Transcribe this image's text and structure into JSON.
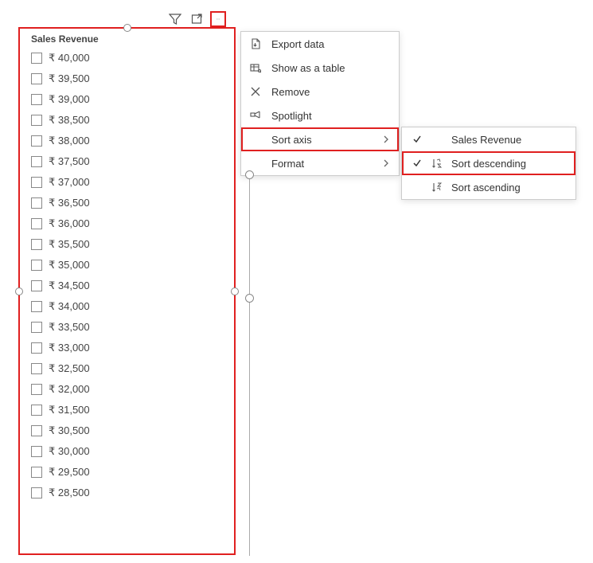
{
  "toolbar": {
    "filter_tooltip": "Filters",
    "focus_tooltip": "Focus mode",
    "more_tooltip": "More options"
  },
  "slicer": {
    "title": "Sales Revenue",
    "items": [
      "₹ 40,000",
      "₹ 39,500",
      "₹ 39,000",
      "₹ 38,500",
      "₹ 38,000",
      "₹ 37,500",
      "₹ 37,000",
      "₹ 36,500",
      "₹ 36,000",
      "₹ 35,500",
      "₹ 35,000",
      "₹ 34,500",
      "₹ 34,000",
      "₹ 33,500",
      "₹ 33,000",
      "₹ 32,500",
      "₹ 32,000",
      "₹ 31,500",
      "₹ 30,500",
      "₹ 30,000",
      "₹ 29,500",
      "₹ 28,500"
    ]
  },
  "context_menu": {
    "export_data": "Export data",
    "show_as_table": "Show as a table",
    "remove": "Remove",
    "spotlight": "Spotlight",
    "sort_axis": "Sort axis",
    "format": "Format"
  },
  "submenu": {
    "sales_revenue": "Sales Revenue",
    "sort_descending": "Sort descending",
    "sort_ascending": "Sort ascending"
  }
}
